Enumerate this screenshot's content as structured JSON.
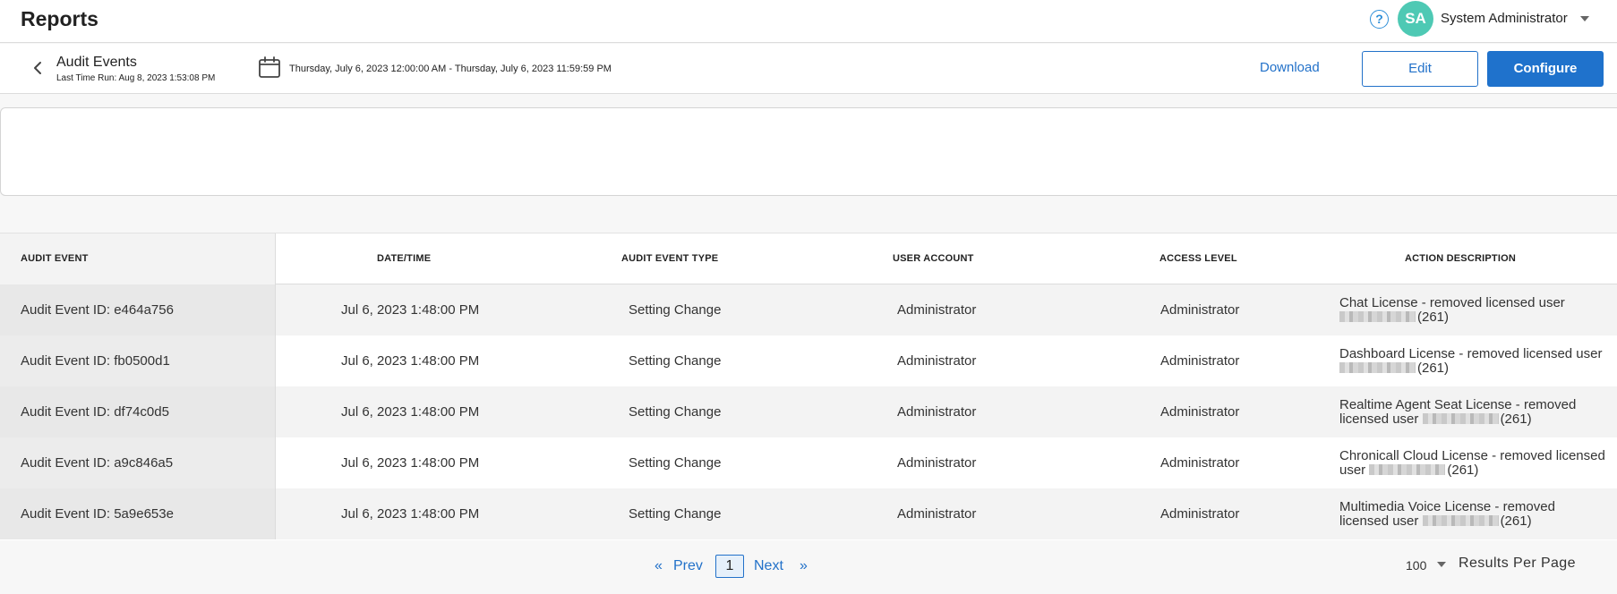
{
  "app": {
    "title": "Reports"
  },
  "user": {
    "initials": "SA",
    "name": "System Administrator",
    "avatar_color": "#4ec9b4"
  },
  "report": {
    "name": "Audit Events",
    "last_run": "Last Time Run: Aug 8, 2023 1:53:08 PM",
    "date_range": "Thursday, July 6, 2023 12:00:00 AM - Thursday, July 6, 2023 11:59:59 PM"
  },
  "actions": {
    "download": "Download",
    "edit": "Edit",
    "configure": "Configure",
    "accent": "#1f72cc"
  },
  "table": {
    "columns": [
      "AUDIT EVENT",
      "DATE/TIME",
      "AUDIT EVENT TYPE",
      "USER ACCOUNT",
      "ACCESS LEVEL",
      "ACTION DESCRIPTION"
    ],
    "rows": [
      {
        "event": "Audit Event ID: e464a756",
        "datetime": "Jul 6, 2023 1:48:00 PM",
        "type": "Setting Change",
        "account": "Administrator",
        "access": "Administrator",
        "desc_pre": "Chat License - removed licensed user",
        "desc_post": "(261)"
      },
      {
        "event": "Audit Event ID: fb0500d1",
        "datetime": "Jul 6, 2023 1:48:00 PM",
        "type": "Setting Change",
        "account": "Administrator",
        "access": "Administrator",
        "desc_pre": "Dashboard License - removed licensed user",
        "desc_post": "(261)"
      },
      {
        "event": "Audit Event ID: df74c0d5",
        "datetime": "Jul 6, 2023 1:48:00 PM",
        "type": "Setting Change",
        "account": "Administrator",
        "access": "Administrator",
        "desc_pre": "Realtime Agent Seat License - removed licensed user",
        "desc_post": "(261)"
      },
      {
        "event": "Audit Event ID: a9c846a5",
        "datetime": "Jul 6, 2023 1:48:00 PM",
        "type": "Setting Change",
        "account": "Administrator",
        "access": "Administrator",
        "desc_pre": "Chronicall Cloud License - removed licensed user",
        "desc_post": "(261)"
      },
      {
        "event": "Audit Event ID: 5a9e653e",
        "datetime": "Jul 6, 2023 1:48:00 PM",
        "type": "Setting Change",
        "account": "Administrator",
        "access": "Administrator",
        "desc_pre": "Multimedia Voice License - removed licensed user",
        "desc_post": "(261)"
      }
    ]
  },
  "pagination": {
    "first": "«",
    "prev": "Prev",
    "current": "1",
    "next": "Next",
    "last": "»",
    "per_page_value": "100",
    "per_page_label": "Results Per Page"
  }
}
